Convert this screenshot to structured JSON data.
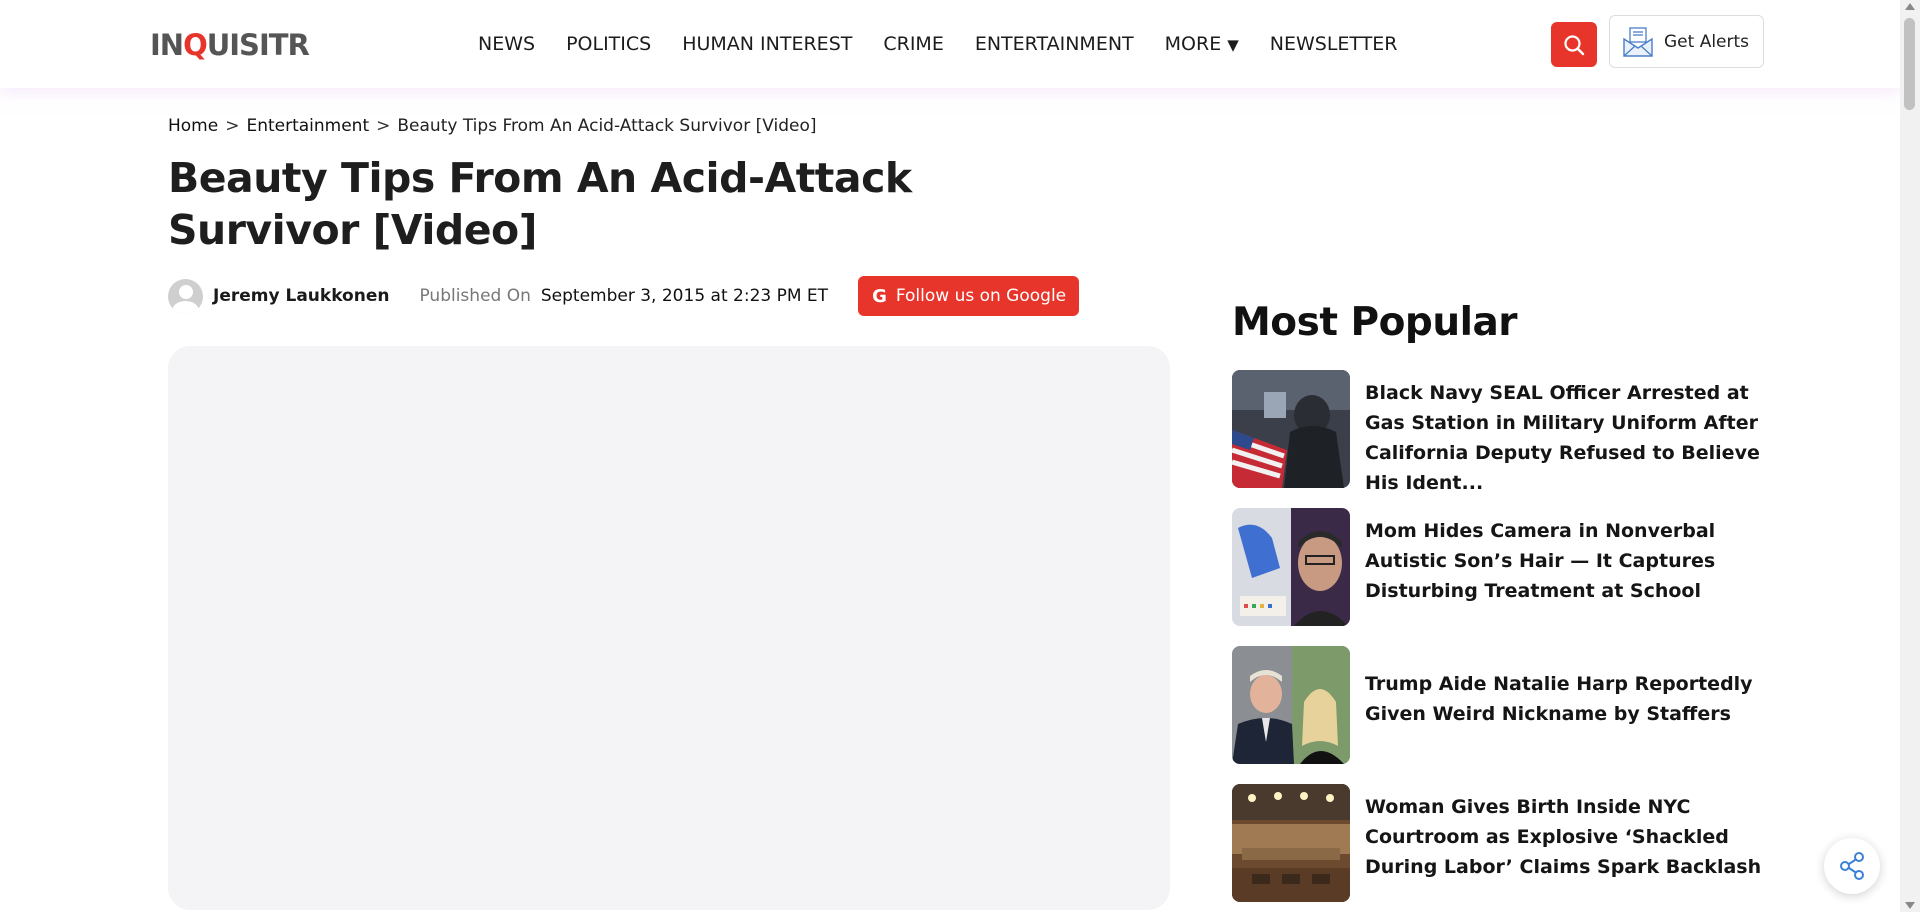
{
  "header": {
    "logo_prefix": "IN",
    "logo_q": "Q",
    "logo_suffix": "UISITR",
    "nav": [
      {
        "label": "NEWS"
      },
      {
        "label": "POLITICS"
      },
      {
        "label": "HUMAN INTEREST"
      },
      {
        "label": "CRIME"
      },
      {
        "label": "ENTERTAINMENT"
      },
      {
        "label": "MORE",
        "caret": "▼"
      },
      {
        "label": "NEWSLETTER"
      }
    ],
    "search_icon": "search-icon",
    "alerts_label": "Get Alerts",
    "alerts_icon": "news-envelope-icon"
  },
  "breadcrumb": {
    "home": "Home",
    "section": "Entertainment",
    "current": "Beauty Tips From An Acid-Attack Survivor [Video]",
    "separator": ">"
  },
  "article": {
    "title": "Beauty Tips From An Acid-Attack Survivor [Video]",
    "author": "Jeremy Laukkonen",
    "published_label": "Published On",
    "published_date": "September 3, 2015 at 2:23 PM ET",
    "follow_label": "Follow us on Google",
    "follow_icon_letter": "G"
  },
  "sidebar": {
    "title": "Most Popular",
    "items": [
      {
        "title": "Black Navy SEAL Officer Arrested at Gas Station in Military Uniform After California Deputy Refused to Believe His Ident..."
      },
      {
        "title": "Mom Hides Camera in Nonverbal Autistic Son’s Hair — It Captures Disturbing Treatment at School"
      },
      {
        "title": "Trump Aide Natalie Harp Reportedly Given Weird Nickname by Staffers"
      },
      {
        "title": "Woman Gives Birth Inside NYC Courtroom as Explosive ‘Shackled During Labor’ Claims Spark Backlash"
      }
    ]
  },
  "colors": {
    "accent": "#e8352b",
    "text": "#1a1a1a",
    "placeholder": "#f4f4f7"
  },
  "share_icon": "share-icon"
}
